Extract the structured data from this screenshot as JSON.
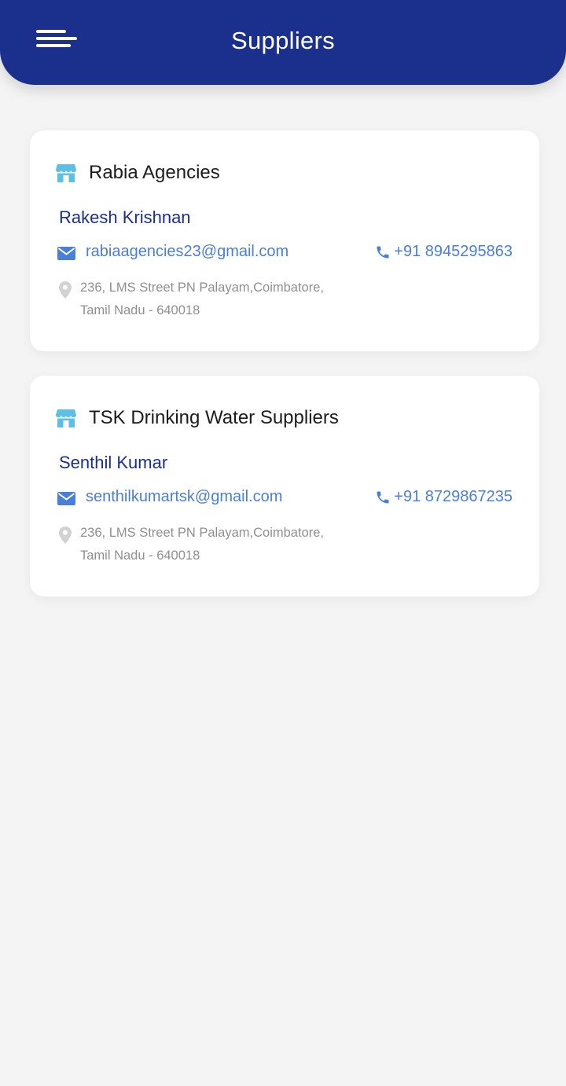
{
  "header": {
    "title": "Suppliers",
    "menu_icon": "hamburger-menu-icon",
    "background_color": "#1b2f8c"
  },
  "colors": {
    "accent": "#4a7fd8",
    "contact_name": "#1b2f8c",
    "store_icon": "#5bbfe6",
    "address_text": "#8f8f8f",
    "page_background": "#f4f4f4"
  },
  "suppliers": [
    {
      "name": "Rabia Agencies",
      "contact": "Rakesh Krishnan",
      "email": "rabiaagencies23@gmail.com",
      "phone": "+91 8945295863",
      "address_line1": "236, LMS Street PN Palayam,Coimbatore,",
      "address_line2": "Tamil Nadu - 640018"
    },
    {
      "name": "TSK Drinking Water Suppliers",
      "contact": "Senthil Kumar",
      "email": "senthilkumartsk@gmail.com",
      "phone": "+91 8729867235",
      "address_line1": "236, LMS Street PN Palayam,Coimbatore,",
      "address_line2": "Tamil Nadu - 640018"
    }
  ]
}
